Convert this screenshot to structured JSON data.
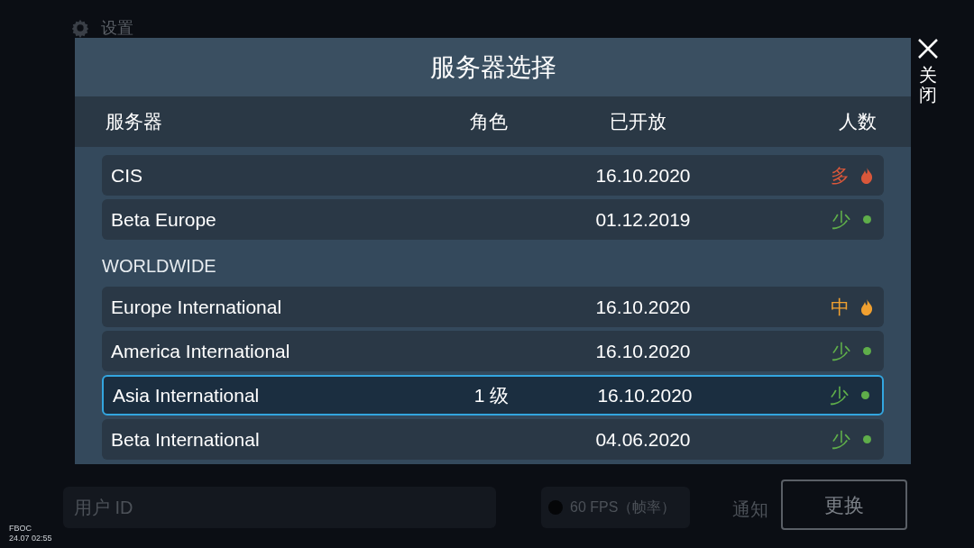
{
  "background": {
    "title": "设置",
    "user_id_field": {
      "placeholder": "用户 ID"
    },
    "fps_toggle": {
      "label": "60 FPS（帧率）",
      "on": false
    },
    "notice_label": "通知",
    "change_button": "更换"
  },
  "overlay": {
    "app_tag": "FBOC",
    "timestamp": "24.07 02:55"
  },
  "dialog": {
    "title": "服务器选择",
    "close_label": "关闭",
    "columns": [
      "服务器",
      "角色",
      "已开放",
      "人数"
    ],
    "rows": [
      {
        "kind": "server",
        "name": "CIS",
        "opened": "16.10.2020",
        "load": {
          "label": "多",
          "kind": "flame",
          "color": "#d9573a"
        },
        "selected": false
      },
      {
        "kind": "server",
        "name": "Beta Europe",
        "opened": "01.12.2019",
        "load": {
          "label": "少",
          "kind": "dot",
          "color": "#5fae4a"
        },
        "selected": false
      },
      {
        "kind": "section",
        "name": "WORLDWIDE"
      },
      {
        "kind": "server",
        "name": "Europe International",
        "opened": "16.10.2020",
        "load": {
          "label": "中",
          "kind": "flame",
          "color": "#f0a030"
        },
        "selected": false
      },
      {
        "kind": "server",
        "name": "America International",
        "opened": "16.10.2020",
        "load": {
          "label": "少",
          "kind": "dot",
          "color": "#5fae4a"
        },
        "selected": false
      },
      {
        "kind": "server",
        "name": "Asia International",
        "role": "1 级",
        "opened": "16.10.2020",
        "load": {
          "label": "少",
          "kind": "dot",
          "color": "#5fae4a"
        },
        "selected": true
      },
      {
        "kind": "server",
        "name": "Beta International",
        "opened": "04.06.2020",
        "load": {
          "label": "少",
          "kind": "dot",
          "color": "#5fae4a"
        },
        "selected": false
      }
    ]
  }
}
